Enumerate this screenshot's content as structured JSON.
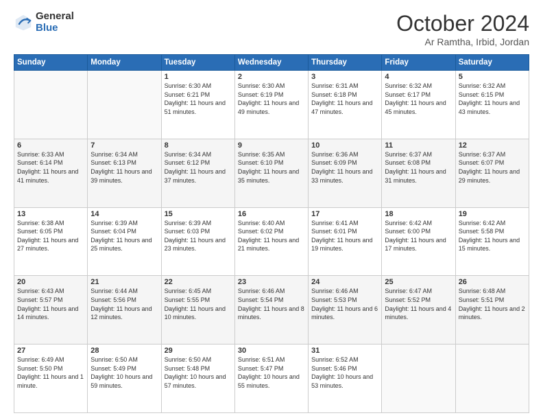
{
  "header": {
    "logo_general": "General",
    "logo_blue": "Blue",
    "month_title": "October 2024",
    "location": "Ar Ramtha, Irbid, Jordan"
  },
  "days_of_week": [
    "Sunday",
    "Monday",
    "Tuesday",
    "Wednesday",
    "Thursday",
    "Friday",
    "Saturday"
  ],
  "weeks": [
    [
      {
        "num": "",
        "sunrise": "",
        "sunset": "",
        "daylight": ""
      },
      {
        "num": "",
        "sunrise": "",
        "sunset": "",
        "daylight": ""
      },
      {
        "num": "1",
        "sunrise": "Sunrise: 6:30 AM",
        "sunset": "Sunset: 6:21 PM",
        "daylight": "Daylight: 11 hours and 51 minutes."
      },
      {
        "num": "2",
        "sunrise": "Sunrise: 6:30 AM",
        "sunset": "Sunset: 6:19 PM",
        "daylight": "Daylight: 11 hours and 49 minutes."
      },
      {
        "num": "3",
        "sunrise": "Sunrise: 6:31 AM",
        "sunset": "Sunset: 6:18 PM",
        "daylight": "Daylight: 11 hours and 47 minutes."
      },
      {
        "num": "4",
        "sunrise": "Sunrise: 6:32 AM",
        "sunset": "Sunset: 6:17 PM",
        "daylight": "Daylight: 11 hours and 45 minutes."
      },
      {
        "num": "5",
        "sunrise": "Sunrise: 6:32 AM",
        "sunset": "Sunset: 6:15 PM",
        "daylight": "Daylight: 11 hours and 43 minutes."
      }
    ],
    [
      {
        "num": "6",
        "sunrise": "Sunrise: 6:33 AM",
        "sunset": "Sunset: 6:14 PM",
        "daylight": "Daylight: 11 hours and 41 minutes."
      },
      {
        "num": "7",
        "sunrise": "Sunrise: 6:34 AM",
        "sunset": "Sunset: 6:13 PM",
        "daylight": "Daylight: 11 hours and 39 minutes."
      },
      {
        "num": "8",
        "sunrise": "Sunrise: 6:34 AM",
        "sunset": "Sunset: 6:12 PM",
        "daylight": "Daylight: 11 hours and 37 minutes."
      },
      {
        "num": "9",
        "sunrise": "Sunrise: 6:35 AM",
        "sunset": "Sunset: 6:10 PM",
        "daylight": "Daylight: 11 hours and 35 minutes."
      },
      {
        "num": "10",
        "sunrise": "Sunrise: 6:36 AM",
        "sunset": "Sunset: 6:09 PM",
        "daylight": "Daylight: 11 hours and 33 minutes."
      },
      {
        "num": "11",
        "sunrise": "Sunrise: 6:37 AM",
        "sunset": "Sunset: 6:08 PM",
        "daylight": "Daylight: 11 hours and 31 minutes."
      },
      {
        "num": "12",
        "sunrise": "Sunrise: 6:37 AM",
        "sunset": "Sunset: 6:07 PM",
        "daylight": "Daylight: 11 hours and 29 minutes."
      }
    ],
    [
      {
        "num": "13",
        "sunrise": "Sunrise: 6:38 AM",
        "sunset": "Sunset: 6:05 PM",
        "daylight": "Daylight: 11 hours and 27 minutes."
      },
      {
        "num": "14",
        "sunrise": "Sunrise: 6:39 AM",
        "sunset": "Sunset: 6:04 PM",
        "daylight": "Daylight: 11 hours and 25 minutes."
      },
      {
        "num": "15",
        "sunrise": "Sunrise: 6:39 AM",
        "sunset": "Sunset: 6:03 PM",
        "daylight": "Daylight: 11 hours and 23 minutes."
      },
      {
        "num": "16",
        "sunrise": "Sunrise: 6:40 AM",
        "sunset": "Sunset: 6:02 PM",
        "daylight": "Daylight: 11 hours and 21 minutes."
      },
      {
        "num": "17",
        "sunrise": "Sunrise: 6:41 AM",
        "sunset": "Sunset: 6:01 PM",
        "daylight": "Daylight: 11 hours and 19 minutes."
      },
      {
        "num": "18",
        "sunrise": "Sunrise: 6:42 AM",
        "sunset": "Sunset: 6:00 PM",
        "daylight": "Daylight: 11 hours and 17 minutes."
      },
      {
        "num": "19",
        "sunrise": "Sunrise: 6:42 AM",
        "sunset": "Sunset: 5:58 PM",
        "daylight": "Daylight: 11 hours and 15 minutes."
      }
    ],
    [
      {
        "num": "20",
        "sunrise": "Sunrise: 6:43 AM",
        "sunset": "Sunset: 5:57 PM",
        "daylight": "Daylight: 11 hours and 14 minutes."
      },
      {
        "num": "21",
        "sunrise": "Sunrise: 6:44 AM",
        "sunset": "Sunset: 5:56 PM",
        "daylight": "Daylight: 11 hours and 12 minutes."
      },
      {
        "num": "22",
        "sunrise": "Sunrise: 6:45 AM",
        "sunset": "Sunset: 5:55 PM",
        "daylight": "Daylight: 11 hours and 10 minutes."
      },
      {
        "num": "23",
        "sunrise": "Sunrise: 6:46 AM",
        "sunset": "Sunset: 5:54 PM",
        "daylight": "Daylight: 11 hours and 8 minutes."
      },
      {
        "num": "24",
        "sunrise": "Sunrise: 6:46 AM",
        "sunset": "Sunset: 5:53 PM",
        "daylight": "Daylight: 11 hours and 6 minutes."
      },
      {
        "num": "25",
        "sunrise": "Sunrise: 6:47 AM",
        "sunset": "Sunset: 5:52 PM",
        "daylight": "Daylight: 11 hours and 4 minutes."
      },
      {
        "num": "26",
        "sunrise": "Sunrise: 6:48 AM",
        "sunset": "Sunset: 5:51 PM",
        "daylight": "Daylight: 11 hours and 2 minutes."
      }
    ],
    [
      {
        "num": "27",
        "sunrise": "Sunrise: 6:49 AM",
        "sunset": "Sunset: 5:50 PM",
        "daylight": "Daylight: 11 hours and 1 minute."
      },
      {
        "num": "28",
        "sunrise": "Sunrise: 6:50 AM",
        "sunset": "Sunset: 5:49 PM",
        "daylight": "Daylight: 10 hours and 59 minutes."
      },
      {
        "num": "29",
        "sunrise": "Sunrise: 6:50 AM",
        "sunset": "Sunset: 5:48 PM",
        "daylight": "Daylight: 10 hours and 57 minutes."
      },
      {
        "num": "30",
        "sunrise": "Sunrise: 6:51 AM",
        "sunset": "Sunset: 5:47 PM",
        "daylight": "Daylight: 10 hours and 55 minutes."
      },
      {
        "num": "31",
        "sunrise": "Sunrise: 6:52 AM",
        "sunset": "Sunset: 5:46 PM",
        "daylight": "Daylight: 10 hours and 53 minutes."
      },
      {
        "num": "",
        "sunrise": "",
        "sunset": "",
        "daylight": ""
      },
      {
        "num": "",
        "sunrise": "",
        "sunset": "",
        "daylight": ""
      }
    ]
  ]
}
